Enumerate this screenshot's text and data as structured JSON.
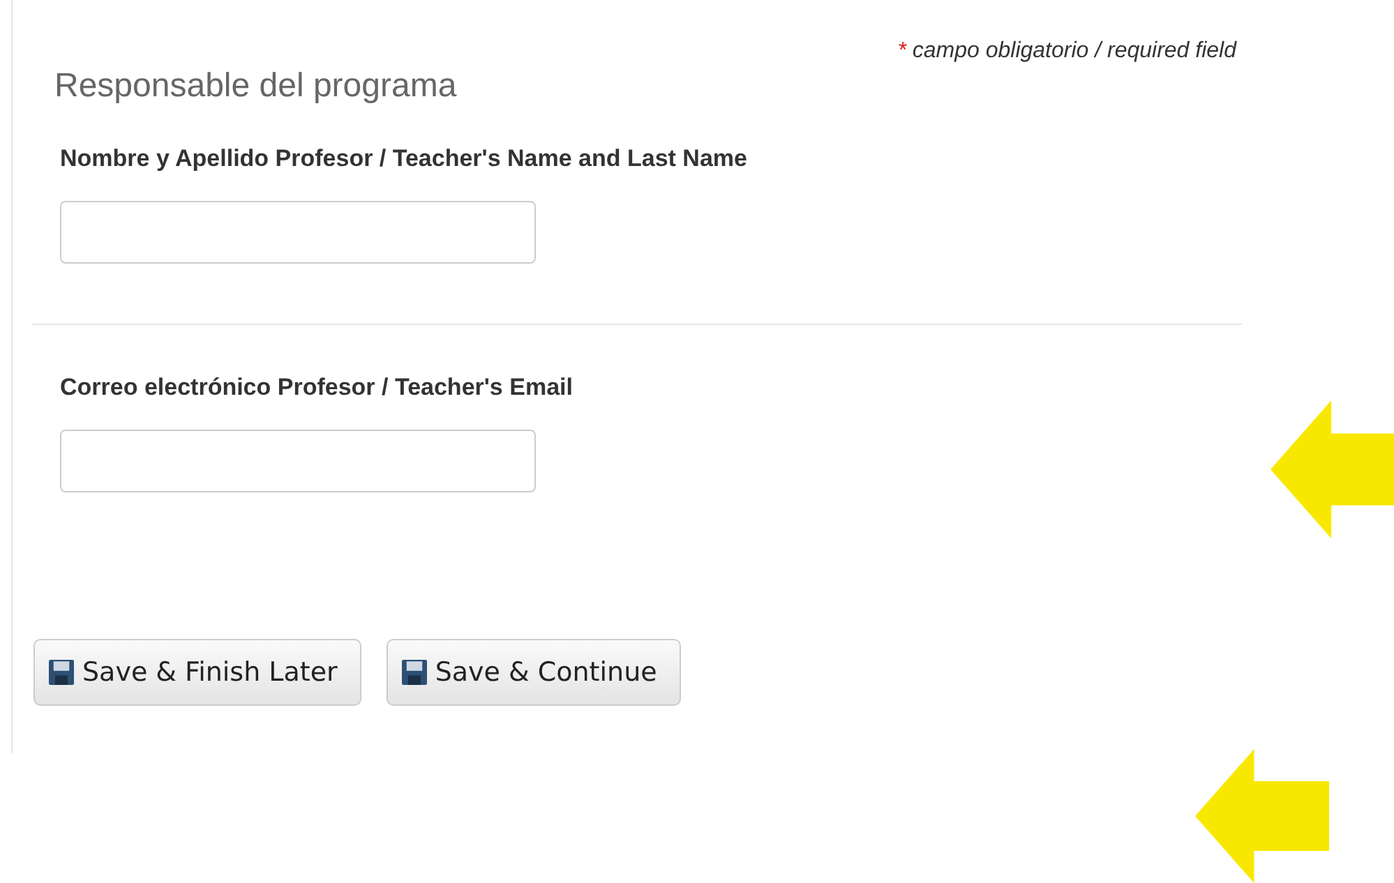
{
  "required_note": {
    "mark": "*",
    "text": "campo obligatorio / required field"
  },
  "section": {
    "title": "Responsable del programa"
  },
  "fields": [
    {
      "label": "Nombre y Apellido Profesor / Teacher's Name and Last Name"
    },
    {
      "label": "Correo electrónico Profesor / Teacher's Email"
    }
  ],
  "buttons": [
    {
      "label": "Save & Finish Later"
    },
    {
      "label": "Save & Continue"
    }
  ],
  "annotations": [
    {
      "kind": "arrow"
    },
    {
      "kind": "arrow"
    }
  ]
}
